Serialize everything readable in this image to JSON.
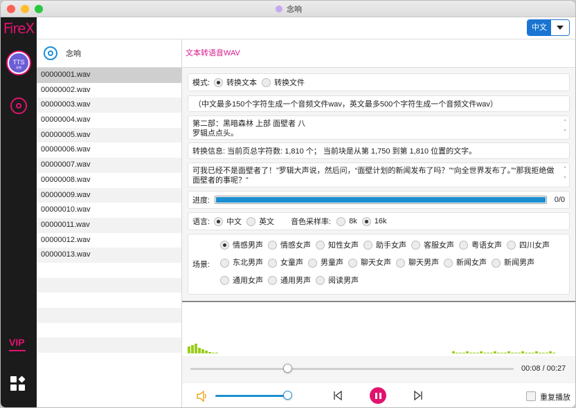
{
  "window": {
    "title": "念响"
  },
  "brand": {
    "logo_text": "FireX",
    "vip_label": "VIP",
    "avatar_text": "TTS",
    "avatar_subtext": "念响",
    "accent": "#e2136e"
  },
  "header": {
    "language": "中文"
  },
  "filelist": {
    "title": "念响",
    "selected_index": 0,
    "files": [
      "00000001.wav",
      "00000002.wav",
      "00000003.wav",
      "00000004.wav",
      "00000005.wav",
      "00000006.wav",
      "00000007.wav",
      "00000008.wav",
      "00000009.wav",
      "00000010.wav",
      "00000011.wav",
      "00000012.wav",
      "00000013.wav"
    ]
  },
  "main": {
    "title": "文本转语音WAV",
    "mode": {
      "label": "模式:",
      "options": [
        "转换文本",
        "转换文件"
      ],
      "selected": "转换文本"
    },
    "hint": "（中文最多150个字符生成一个音频文件wav，英文最多500个字符生成一个音频文件wav）",
    "source_text": {
      "line1": "第二部：黑暗森林 上部 面壁者 八",
      "line2": "罗辑点点头。"
    },
    "info": "转换信息:  当前页总字符数: 1,810 个；  当前块是从第 1,750 到第 1,810 位置的文字。",
    "current_text": {
      "line1": "可我已经不是面壁者了！”罗辑大声说，然后问，“面壁计划的新闻发布了吗？”“向全世界发布了。”“那我拒绝做",
      "line2": "面壁者的事呢？”"
    },
    "progress": {
      "label": "进度:",
      "value": 1.0,
      "count": "0/0"
    },
    "language": {
      "label": "语言:",
      "options": [
        "中文",
        "英文"
      ],
      "selected": "中文"
    },
    "sample_rate": {
      "label": "音色采样率:",
      "options": [
        "8k",
        "16k"
      ],
      "selected": "16k"
    },
    "scene": {
      "label": "场景:",
      "rows": [
        [
          "情感男声",
          "情感女声",
          "知性女声",
          "助手女声",
          "客服女声",
          "粤语女声",
          "四川女声"
        ],
        [
          "东北男声",
          "女童声",
          "男童声",
          "聊天女声",
          "聊天男声",
          "新闻女声",
          "新闻男声"
        ],
        [
          "通用女声",
          "通用男声",
          "阅读男声"
        ]
      ],
      "selected": "情感男声"
    }
  },
  "player": {
    "current_time": "00:08",
    "separator": "/",
    "total_time": "00:27",
    "position": 0.3,
    "volume": 1.0,
    "repeat_label": "重复播放",
    "repeat": false
  }
}
